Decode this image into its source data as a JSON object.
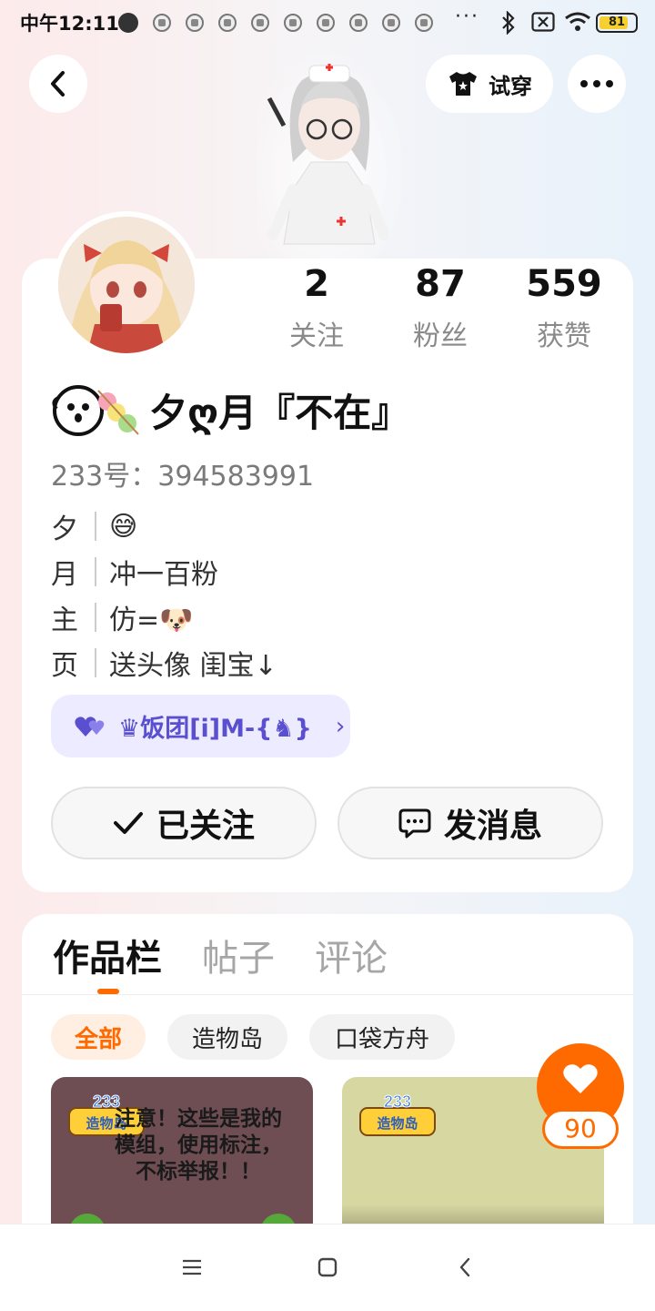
{
  "status_bar": {
    "time": "中午12:11",
    "dots": "···",
    "battery": "81",
    "battery_level": 0.81
  },
  "header": {
    "try_on_label": "试穿"
  },
  "profile": {
    "stats": [
      {
        "value": "2",
        "label": "关注"
      },
      {
        "value": "87",
        "label": "粉丝"
      },
      {
        "value": "559",
        "label": "获赞"
      }
    ],
    "nickname": "夕ღ月『不在』",
    "id_text": "233号：394583991",
    "bio": [
      {
        "key": "夕",
        "text": "😅"
      },
      {
        "key": "月",
        "text": "冲一百粉"
      },
      {
        "key": "主",
        "text": "仿=🐶"
      },
      {
        "key": "页",
        "text": "送头像  闺宝↓"
      }
    ],
    "fan_group": "♛饭团[i]M-{♞}",
    "follow_label": "已关注",
    "message_label": "发消息"
  },
  "works": {
    "tabs": [
      "作品栏",
      "帖子",
      "评论"
    ],
    "chips": [
      "全部",
      "造物岛",
      "口袋方舟"
    ],
    "cards": [
      {
        "badge": "233 造物岛",
        "text": "注意！这些是我的模组，使用标注，不标举报！！",
        "color": "#6e4e52"
      },
      {
        "badge": "233 造物岛",
        "text": "",
        "color": "#d7d7a2"
      }
    ],
    "like_count": "90"
  },
  "colors": {
    "accent": "#ff6a00",
    "fan_group": "#5a4fcf"
  }
}
